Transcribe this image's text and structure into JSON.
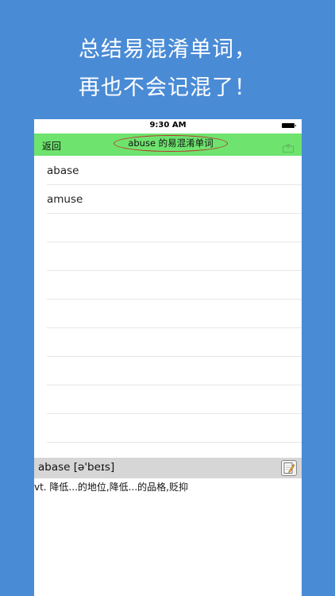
{
  "promo": {
    "line1": "总结易混淆单词，",
    "line2": "再也不会记混了！"
  },
  "status_bar": {
    "time": "9:30 AM"
  },
  "nav": {
    "back_label": "返回",
    "title": "abuse 的易混淆单词"
  },
  "words": [
    "abase",
    "amuse",
    "",
    "",
    "",
    "",
    "",
    "",
    "",
    ""
  ],
  "detail": {
    "headword": "abase [ə'beɪs]",
    "definition": "vt. 降低...的地位,降低...的品格,贬抑"
  },
  "colors": {
    "background": "#4a8bd6",
    "nav_bar": "#6ee36e",
    "highlight_ring": "#c0302a",
    "detail_bar": "#d6d6d6"
  }
}
